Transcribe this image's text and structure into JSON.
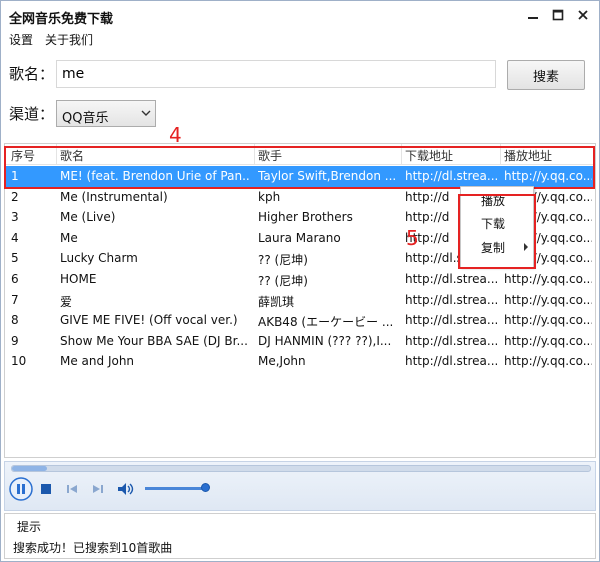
{
  "window": {
    "title": "全网音乐免费下载"
  },
  "menu": {
    "items": [
      "设置",
      "关于我们"
    ]
  },
  "search": {
    "label": "歌名：",
    "value": "me",
    "button_label": "搜素"
  },
  "channel": {
    "label": "渠道：",
    "selected": "QQ音乐"
  },
  "table": {
    "columns": [
      "序号",
      "歌名",
      "歌手",
      "下载地址",
      "播放地址"
    ],
    "rows": [
      {
        "no": "1",
        "title": "ME! (feat. Brendon Urie of Pan...",
        "artist": "Taylor Swift,Brendon ...",
        "download": "http://dl.strea...",
        "play": "http://y.qq.co...",
        "selected": true
      },
      {
        "no": "2",
        "title": "Me (Instrumental)",
        "artist": "kph",
        "download": "http://d",
        "play": "http://y.qq.co..."
      },
      {
        "no": "3",
        "title": "Me (Live)",
        "artist": "Higher Brothers",
        "download": "http://d",
        "play": "http://y.qq.co..."
      },
      {
        "no": "4",
        "title": "Me",
        "artist": "Laura Marano",
        "download": "http://d",
        "play": "http://y.qq.co..."
      },
      {
        "no": "5",
        "title": "Lucky Charm",
        "artist": "?? (尼坤)",
        "download": "http://dl.strea...",
        "play": "http://y.qq.co..."
      },
      {
        "no": "6",
        "title": "HOME",
        "artist": "?? (尼坤)",
        "download": "http://dl.strea...",
        "play": "http://y.qq.co..."
      },
      {
        "no": "7",
        "title": "爱",
        "artist": "薛凯琪",
        "download": "http://dl.strea...",
        "play": "http://y.qq.co..."
      },
      {
        "no": "8",
        "title": "GIVE ME FIVE! (Off vocal ver.)",
        "artist": "AKB48 (エーケービー ...",
        "download": "http://dl.strea...",
        "play": "http://y.qq.co..."
      },
      {
        "no": "9",
        "title": "Show Me Your BBA SAE (DJ Br...",
        "artist": "DJ HANMIN (??? ??),I...",
        "download": "http://dl.strea...",
        "play": "http://y.qq.co..."
      },
      {
        "no": "10",
        "title": "Me and John",
        "artist": "Me,John",
        "download": "http://dl.strea...",
        "play": "http://y.qq.co..."
      }
    ]
  },
  "context_menu": {
    "items": [
      "播放",
      "下载",
      "复制"
    ]
  },
  "annotations": {
    "marker_4": "4",
    "marker_5": "5"
  },
  "player": {
    "progress": 0.06,
    "volume": 0.95
  },
  "status": {
    "title": "提示",
    "message": "搜索成功！已搜索到10首歌曲"
  },
  "colors": {
    "selection": "#3399ff",
    "annotation": "#e52222",
    "accent": "#2a6fd0"
  }
}
